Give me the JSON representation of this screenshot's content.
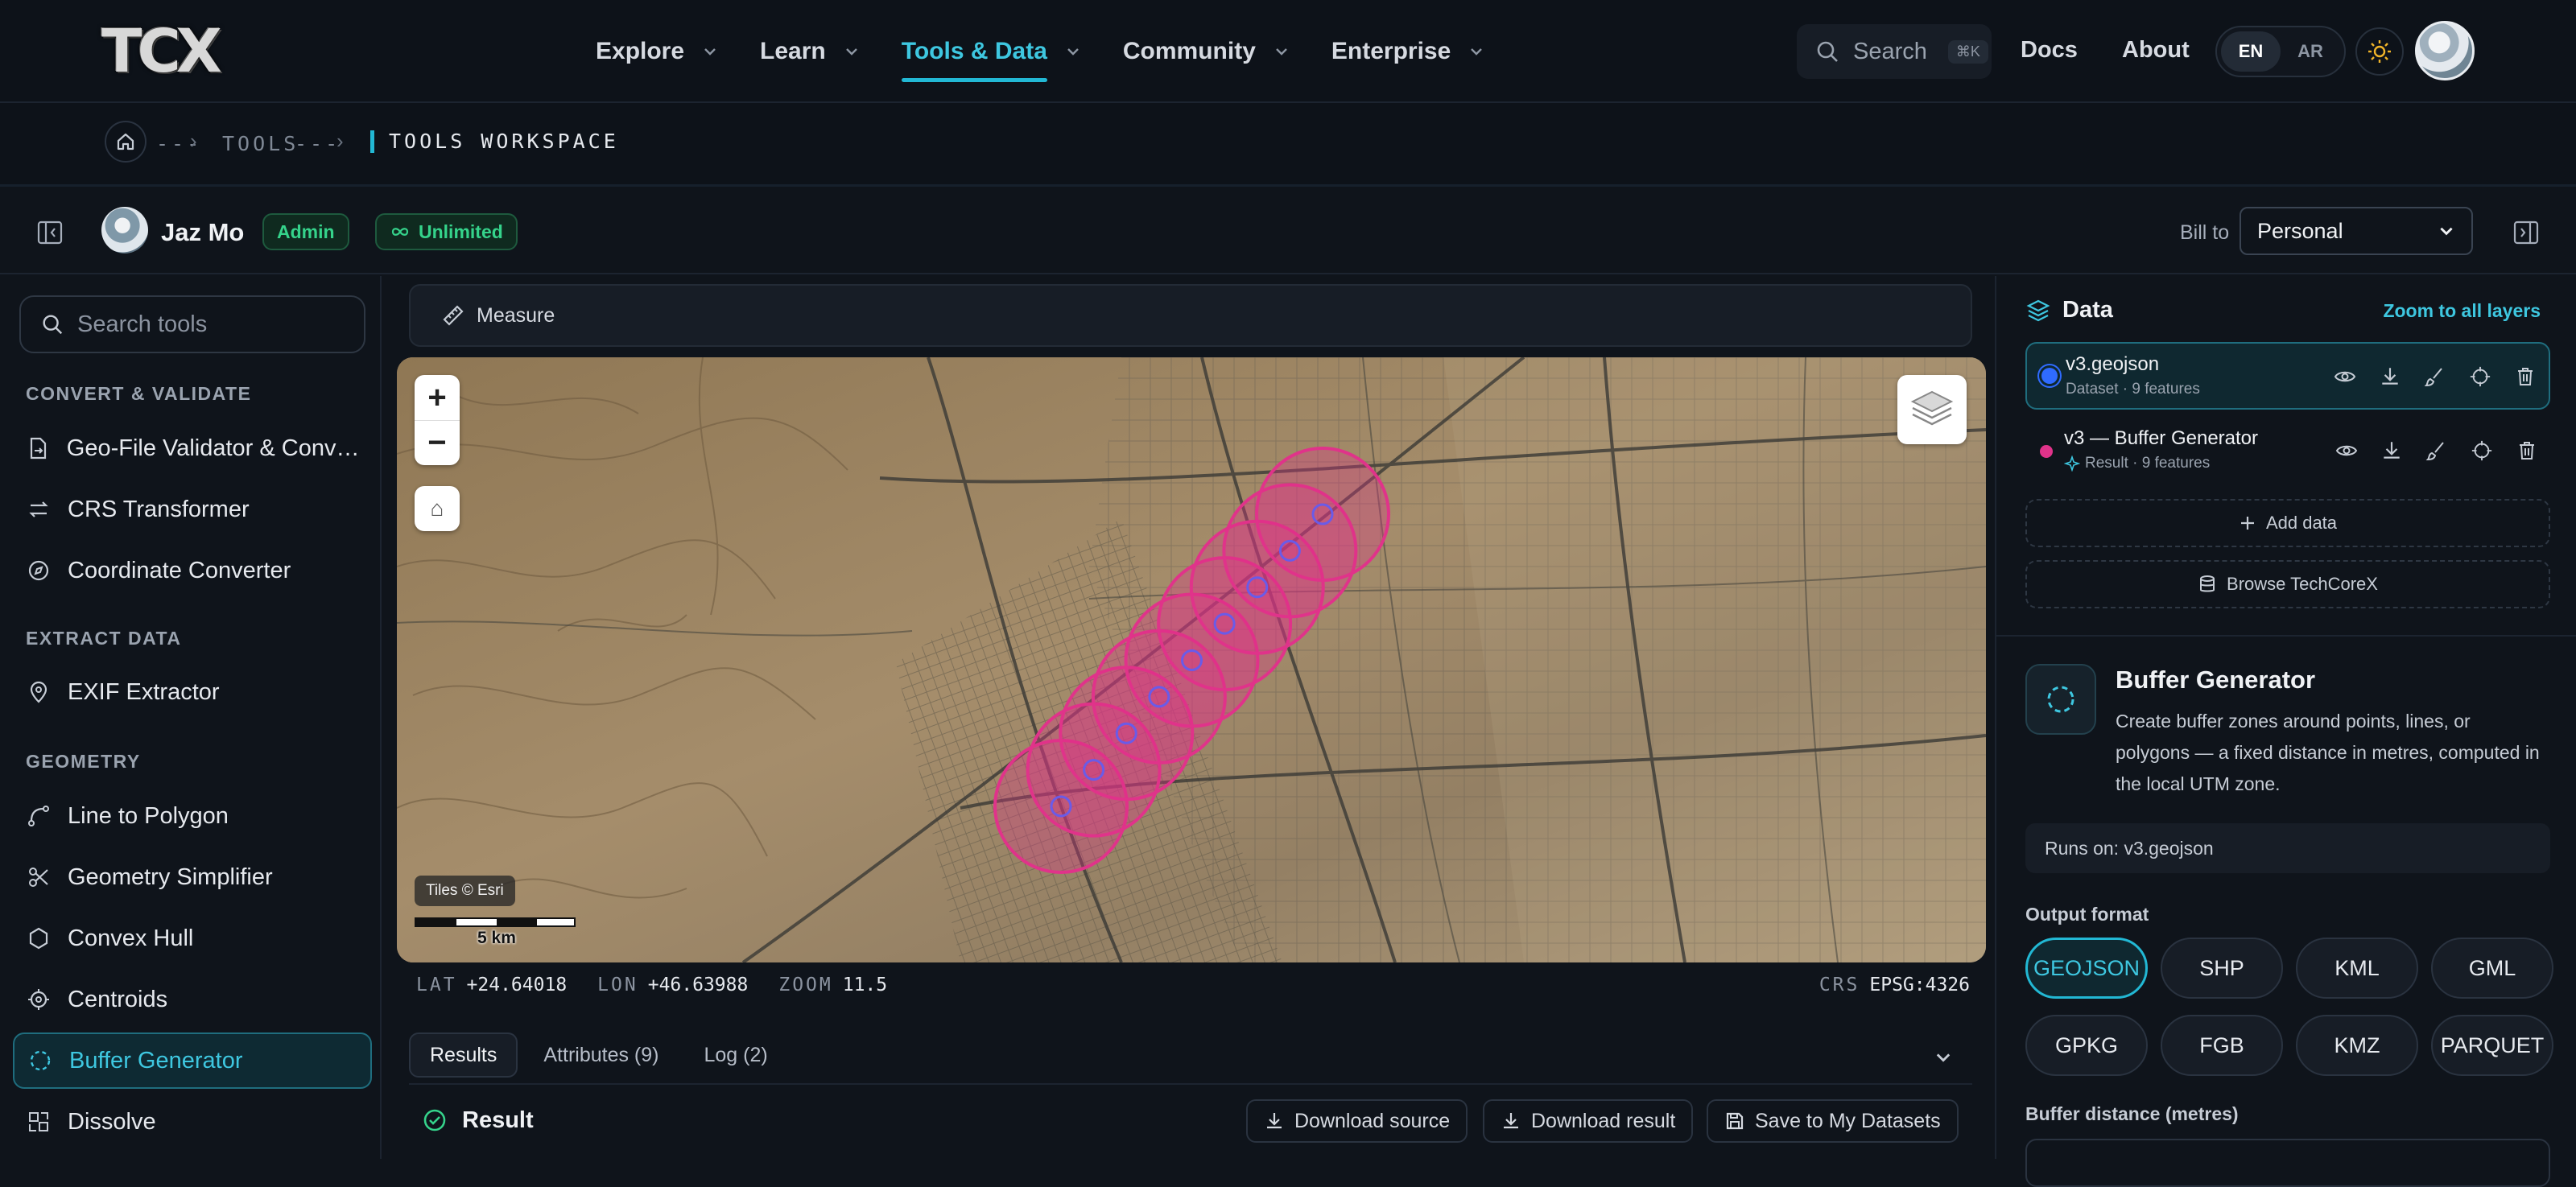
{
  "brand": {
    "logo_text": "TCX"
  },
  "nav": {
    "items": [
      {
        "label": "Explore",
        "active": false
      },
      {
        "label": "Learn",
        "active": false
      },
      {
        "label": "Tools & Data",
        "active": true
      },
      {
        "label": "Community",
        "active": false
      },
      {
        "label": "Enterprise",
        "active": false
      }
    ],
    "search_label": "Search",
    "search_shortcut": "⌘K",
    "docs": "Docs",
    "about": "About",
    "lang": [
      "EN",
      "AR"
    ],
    "lang_selected": "EN"
  },
  "breadcrumb": {
    "ellipsis1": "---",
    "tools": "TOOLS",
    "ellipsis2": "---",
    "current": "TOOLS WORKSPACE"
  },
  "workspace": {
    "user_name": "Jaz Mo",
    "role_badge": "Admin",
    "plan_badge": "Unlimited",
    "bill_to_label": "Bill to",
    "bill_to_value": "Personal"
  },
  "sidebar": {
    "search_placeholder": "Search tools",
    "sections": [
      {
        "title": "CONVERT & VALIDATE",
        "items": [
          "Geo-File Validator & Converter",
          "CRS Transformer",
          "Coordinate Converter"
        ]
      },
      {
        "title": "EXTRACT DATA",
        "items": [
          "EXIF Extractor"
        ]
      },
      {
        "title": "GEOMETRY",
        "items": [
          "Line to Polygon",
          "Geometry Simplifier",
          "Convex Hull",
          "Centroids",
          "Buffer Generator",
          "Dissolve"
        ]
      }
    ],
    "active_item": "Buffer Generator"
  },
  "toolbar": {
    "measure": "Measure"
  },
  "map": {
    "attribution": "Tiles © Esri",
    "scale_label": "5 km",
    "zoom_in": "+",
    "zoom_out": "−",
    "home": "⌂",
    "buffer_color": "#e0338a"
  },
  "coords": {
    "lat_key": "LAT",
    "lat": "+24.64018",
    "lon_key": "LON",
    "lon": "+46.63988",
    "zoom_key": "ZOOM",
    "zoom": "11.5",
    "crs_key": "CRS",
    "crs": "EPSG:4326"
  },
  "results": {
    "tabs": [
      "Results",
      "Attributes (9)",
      "Log (2)"
    ],
    "active_tab": "Results",
    "title": "Result",
    "download_source": "Download source",
    "download_result": "Download result",
    "save": "Save to My Datasets"
  },
  "data_panel": {
    "title": "Data",
    "zoom_all": "Zoom to all layers",
    "layers": [
      {
        "name": "v3.geojson",
        "meta": "Dataset · 9 features",
        "color": "#2f6bff",
        "selected": true
      },
      {
        "name": "v3 — Buffer Generator",
        "meta": "Result · 9 features",
        "color": "#e0338a",
        "selected": false
      }
    ],
    "add_data": "Add data",
    "browse": "Browse TechCoreX"
  },
  "tool": {
    "title": "Buffer Generator",
    "description": "Create buffer zones around points, lines, or polygons — a fixed distance in metres, computed in the local UTM zone.",
    "runs_on": "Runs on: v3.geojson",
    "output_format_label": "Output format",
    "formats": [
      "GEOJSON",
      "SHP",
      "KML",
      "GML",
      "GPKG",
      "FGB",
      "KMZ",
      "PARQUET"
    ],
    "format_selected": "GEOJSON",
    "buffer_distance_label": "Buffer distance (metres)"
  },
  "colors": {
    "accent": "#22b8d4",
    "success": "#35d38b",
    "background": "#0f141b"
  }
}
